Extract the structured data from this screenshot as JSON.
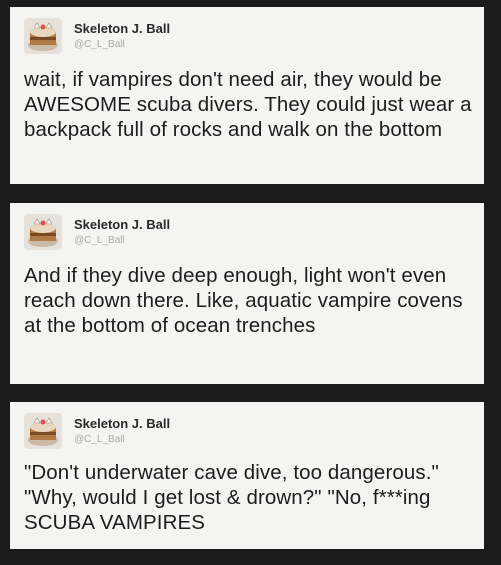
{
  "posts": [
    {
      "author_name": "Skeleton J. Ball",
      "author_handle": "@C_L_Ball",
      "avatar_icon": "cake-avatar-icon",
      "text": "wait, if vampires don't need air, they would be AWESOME scuba divers. They could just wear a backpack full of rocks and walk on the bottom"
    },
    {
      "author_name": "Skeleton J. Ball",
      "author_handle": "@C_L_Ball",
      "avatar_icon": "cake-avatar-icon",
      "text": "And if they dive deep enough, light won't even reach down there. Like, aquatic vampire covens at the bottom of ocean trenches"
    },
    {
      "author_name": "Skeleton J. Ball",
      "author_handle": "@C_L_Ball",
      "avatar_icon": "cake-avatar-icon",
      "text": "\"Don't underwater cave dive, too dangerous.\" \"Why, would I get lost & drown?\" \"No, f***ing SCUBA VAMPIRES"
    }
  ],
  "colors": {
    "page_background": "#1b1b1b",
    "card_background": "#f4f4f2",
    "handle_text": "#a9a9a9",
    "body_text": "#1d1d1d"
  }
}
